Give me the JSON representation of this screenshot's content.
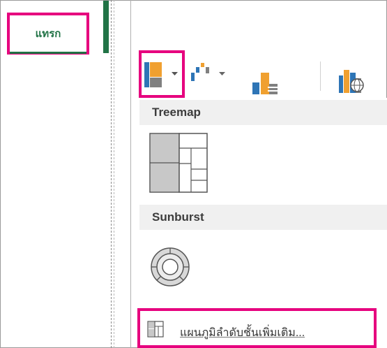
{
  "tabs": {
    "insert_label": "แทรก"
  },
  "gallery": {
    "sections": [
      {
        "title": "Treemap",
        "items": [
          "treemap"
        ]
      },
      {
        "title": "Sunburst",
        "items": [
          "sunburst"
        ]
      }
    ],
    "more_label": "แผนภูมิลำดับชั้นเพิ่มเติม..."
  },
  "icons": [
    "hierarchy-chart-icon",
    "waterfall-chart-icon",
    "statistic-chart-icon",
    "map-chart-icon",
    "treemap-icon",
    "sunburst-icon",
    "more-charts-icon"
  ],
  "colors": {
    "accent": "#e6007e",
    "excel_green": "#217346",
    "orange": "#f0a030",
    "blue": "#2e75b6",
    "gray": "#808080"
  }
}
